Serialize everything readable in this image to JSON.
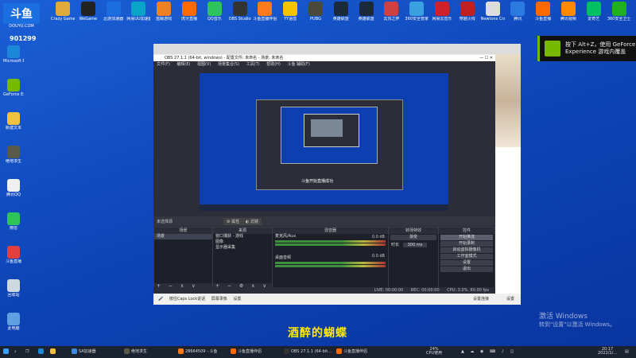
{
  "desktop": {
    "logo_text": "DOUYU.COM",
    "room_number": "901299",
    "top_icons": [
      {
        "label": "Crazy Game",
        "color": "#e0a93c"
      },
      {
        "label": "WeGame",
        "color": "#222222"
      },
      {
        "label": "迅游加速器",
        "color": "#1a6ee0"
      },
      {
        "label": "网易UU加速器",
        "color": "#0aa4c8"
      },
      {
        "label": "蓝鲸游戏",
        "color": "#f08020"
      },
      {
        "label": "虎牙直播",
        "color": "#ff6a00"
      },
      {
        "label": "QQ音乐",
        "color": "#2ec45a"
      },
      {
        "label": "OBS Studio",
        "color": "#333333"
      },
      {
        "label": "斗鱼直播伴侣",
        "color": "#ff7a1a"
      },
      {
        "label": "YY语音",
        "color": "#f5c400"
      },
      {
        "label": "PUBG",
        "color": "#4a4a3a"
      },
      {
        "label": "英雄联盟",
        "color": "#1a2a3a"
      },
      {
        "label": "英雄联盟",
        "color": "#1a2a3a"
      },
      {
        "label": "云顶之弈",
        "color": "#d04040"
      },
      {
        "label": "360安全管家",
        "color": "#3aa0e0"
      },
      {
        "label": "网易云音乐",
        "color": "#d0202a"
      },
      {
        "label": "穿越火线",
        "color": "#c02020"
      },
      {
        "label": "Newtons Cradle",
        "color": "#dddddd"
      },
      {
        "label": "腾讯",
        "color": "#2a7ae0"
      },
      {
        "label": "斗鱼直播",
        "color": "#ff6a00"
      },
      {
        "label": "腾讯视频",
        "color": "#ff8a00"
      },
      {
        "label": "爱奇艺",
        "color": "#00c060"
      },
      {
        "label": "360安全卫士",
        "color": "#20b020"
      }
    ],
    "left_icons": [
      {
        "label": "Microsoft Edge",
        "color": "#1e88d8"
      },
      {
        "label": "GeForce Experience",
        "color": "#76b900"
      },
      {
        "label": "新建文本",
        "color": "#f0c040"
      },
      {
        "label": "绝地求生",
        "color": "#5a5a4a"
      },
      {
        "label": "腾讯QQ",
        "color": "#f0f0f0"
      },
      {
        "label": "微信",
        "color": "#2ec45a"
      },
      {
        "label": "斗鱼直播",
        "color": "#e04040"
      },
      {
        "label": "回收站",
        "color": "#cfd8e0"
      },
      {
        "label": "此电脑",
        "color": "#60a0e0"
      }
    ]
  },
  "nvidia_overlay": {
    "text_line1": "按下 Alt+Z，使用 GeForce",
    "text_line2": "Experience 游戏内覆盖"
  },
  "obs": {
    "title": "OBS 27.1.1 (64-bit, windows) - 配置文件: 未命名 - 场景: 未命名",
    "menu": [
      "文件(F)",
      "编辑(E)",
      "视图(V)",
      "场景集合(S)",
      "工具(T)",
      "帮助(H)",
      "斗鱼 辅助(F)"
    ],
    "source_bar": {
      "label": "未选择源",
      "properties": "属性",
      "filters": "滤镜"
    },
    "docks": {
      "scenes": {
        "title": "场景",
        "items": [
          "场景"
        ]
      },
      "sources": {
        "title": "来源",
        "items": [
          "窗口捕获 - 游戏",
          "图像",
          "显示器采集"
        ]
      },
      "mixer": {
        "title": "混音器",
        "channels": [
          {
            "name": "麦克风/Aux",
            "level": "0.0 dB"
          },
          {
            "name": "桌面音频",
            "level": "0.0 dB"
          }
        ]
      },
      "transitions": {
        "title": "转场特效",
        "type": "渐变",
        "duration_label": "时长",
        "duration": "300 ms"
      },
      "controls": {
        "title": "控件",
        "buttons": [
          "开始推流",
          "开始录制",
          "启动虚拟摄像机",
          "工作室模式",
          "设置",
          "退出"
        ]
      }
    },
    "status": {
      "live": "LIVE: 00:00:00",
      "rec": "REC: 00:00:00",
      "cpu": "CPU: 3.0%, 60.00 fps"
    },
    "preview_caption": "斗鱼开始直播成功"
  },
  "gamebar": {
    "items": [
      "按住Caps Lock说话",
      "屏幕录像",
      "设置"
    ],
    "right": [
      "设置连接",
      "设置"
    ]
  },
  "subtitle": "酒醉的蝴蝶",
  "windows_activate": {
    "line1": "激活 Windows",
    "line2": "转到\"设置\"以激活 Windows。"
  },
  "taskbar": {
    "items": [
      "SA加速器",
      "绝地求生",
      "28664509 - 斗鱼",
      "斗鱼直播伴侣",
      "OBS 27.1.1 (64-bit...",
      "斗鱼直播伴侣"
    ],
    "cpu": "24%",
    "cpu_label": "CPU使用",
    "time": "20:17",
    "date": "2022/1/..."
  }
}
